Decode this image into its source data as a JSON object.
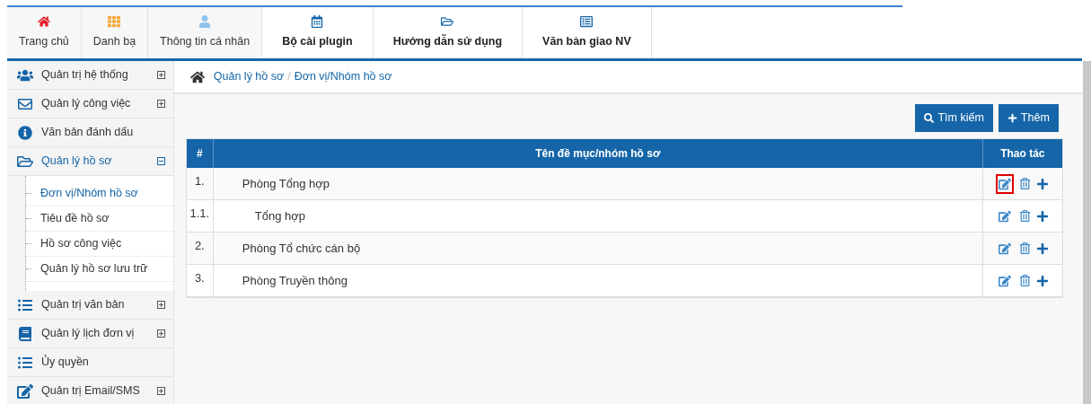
{
  "nav": [
    {
      "label": "Trang chủ",
      "kind": "plain"
    },
    {
      "label": "Danh bạ",
      "kind": "plain"
    },
    {
      "label": "Thông tin cá nhân",
      "kind": "plain"
    },
    {
      "label": "Bộ cài plugin",
      "kind": "featured"
    },
    {
      "label": "Hướng dẫn sử dụng",
      "kind": "featured"
    },
    {
      "label": "Văn bản giao NV",
      "kind": "featured"
    }
  ],
  "sidebar": {
    "items": [
      {
        "label": "Quản trị hệ thống",
        "expanded": false,
        "selected": false
      },
      {
        "label": "Quản lý công việc",
        "expanded": false,
        "selected": false
      },
      {
        "label": "Văn bản đánh dấu",
        "selected": false
      },
      {
        "label": "Quản lý hồ sơ",
        "expanded": true,
        "selected": true,
        "children": [
          {
            "label": "Đơn vị/Nhóm hồ sơ",
            "selected": true
          },
          {
            "label": "Tiêu đề hồ sơ",
            "selected": false
          },
          {
            "label": "Hồ sơ công việc",
            "selected": false
          },
          {
            "label": "Quản lý hồ sơ lưu trữ",
            "selected": false
          }
        ]
      },
      {
        "label": "Quản trị văn bản",
        "expanded": false,
        "selected": false
      },
      {
        "label": "Quản lý lịch đơn vị",
        "expanded": false,
        "selected": false
      },
      {
        "label": "Ủy quyền",
        "selected": false
      },
      {
        "label": "Quản trị Email/SMS",
        "expanded": false,
        "selected": false
      }
    ]
  },
  "breadcrumb": {
    "items": [
      "Quản lý hồ sơ",
      "Đơn vị/Nhóm hồ sơ"
    ],
    "separator": "/"
  },
  "buttons": [
    {
      "label": "Tìm kiếm",
      "kind": "search"
    },
    {
      "label": "Thêm",
      "kind": "add"
    }
  ],
  "table": {
    "columns": [
      "#",
      "Tên đề mục/nhóm hồ sơ",
      "Thao tác"
    ],
    "rows": [
      {
        "number": "1.",
        "name": "Phòng Tổng hợp",
        "edit_highlighted": true,
        "children": [
          {
            "number": "1.1.",
            "name": "Tổng hợp",
            "edit_highlighted": false
          }
        ]
      },
      {
        "number": "2.",
        "name": "Phòng Tổ chức cán bộ",
        "edit_highlighted": false
      },
      {
        "number": "3.",
        "name": "Phòng Truyền thông",
        "edit_highlighted": false
      }
    ]
  }
}
